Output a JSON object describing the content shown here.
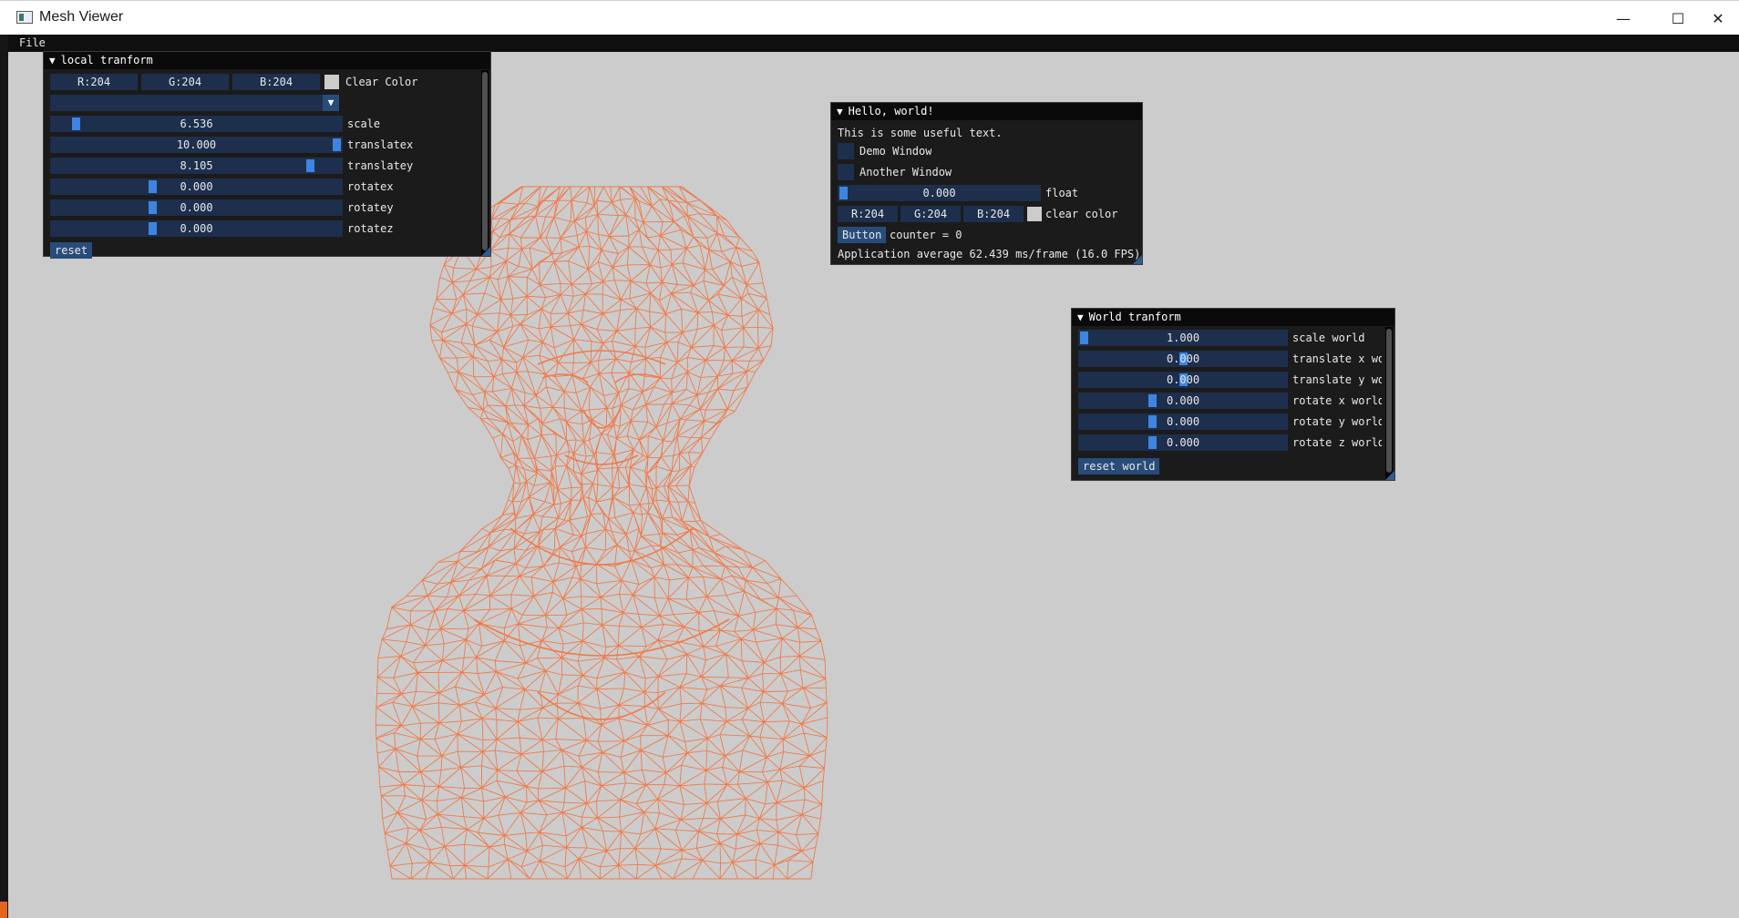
{
  "window": {
    "title": "Mesh Viewer",
    "minimize_symbol": "—",
    "maximize_symbol": "☐",
    "close_symbol": "✕"
  },
  "menubar": {
    "file": "File"
  },
  "colors": {
    "clear_color": "#cccccc",
    "mesh_wire": "#f07a4a",
    "frame_bg": "#1d2f4d",
    "grab": "#3d85e0",
    "button": "#284c7a"
  },
  "local_panel": {
    "title": "local tranform",
    "color": {
      "r": "R:204",
      "g": "G:204",
      "b": "B:204",
      "label": "Clear Color"
    },
    "combo_value": "",
    "sliders": [
      {
        "value": "6.536",
        "label": "scale",
        "fraction": 0.07
      },
      {
        "value": "10.000",
        "label": "translatex",
        "fraction": 1.0
      },
      {
        "value": "8.105",
        "label": "translatey",
        "fraction": 0.905
      },
      {
        "value": "0.000",
        "label": "rotatex",
        "fraction": 0.345
      },
      {
        "value": "0.000",
        "label": "rotatey",
        "fraction": 0.345
      },
      {
        "value": "0.000",
        "label": "rotatez",
        "fraction": 0.345
      }
    ],
    "reset": "reset"
  },
  "hello_panel": {
    "title": "Hello, world!",
    "text": "This is some useful text.",
    "checkbox_demo": "Demo Window",
    "checkbox_another": "Another Window",
    "float_value": "0.000",
    "float_label": "float",
    "float_fraction": 0.0,
    "color": {
      "r": "R:204",
      "g": "G:204",
      "b": "B:204",
      "label": "clear color"
    },
    "button": "Button",
    "counter": "counter = 0",
    "fps": "Application average 62.439 ms/frame (16.0 FPS)"
  },
  "world_panel": {
    "title": "World tranform",
    "sliders": [
      {
        "value": "1.000",
        "label": "scale world",
        "fraction": 0.0
      },
      {
        "value": "0.000",
        "label": "translate x wo",
        "fraction": 0.5
      },
      {
        "value": "0.000",
        "label": "translate y wo",
        "fraction": 0.5
      },
      {
        "value": "0.000",
        "label": "rotate x world",
        "fraction": 0.345
      },
      {
        "value": "0.000",
        "label": "rotate y world",
        "fraction": 0.345
      },
      {
        "value": "0.000",
        "label": "rotate z world",
        "fraction": 0.345
      }
    ],
    "reset": "reset world"
  }
}
